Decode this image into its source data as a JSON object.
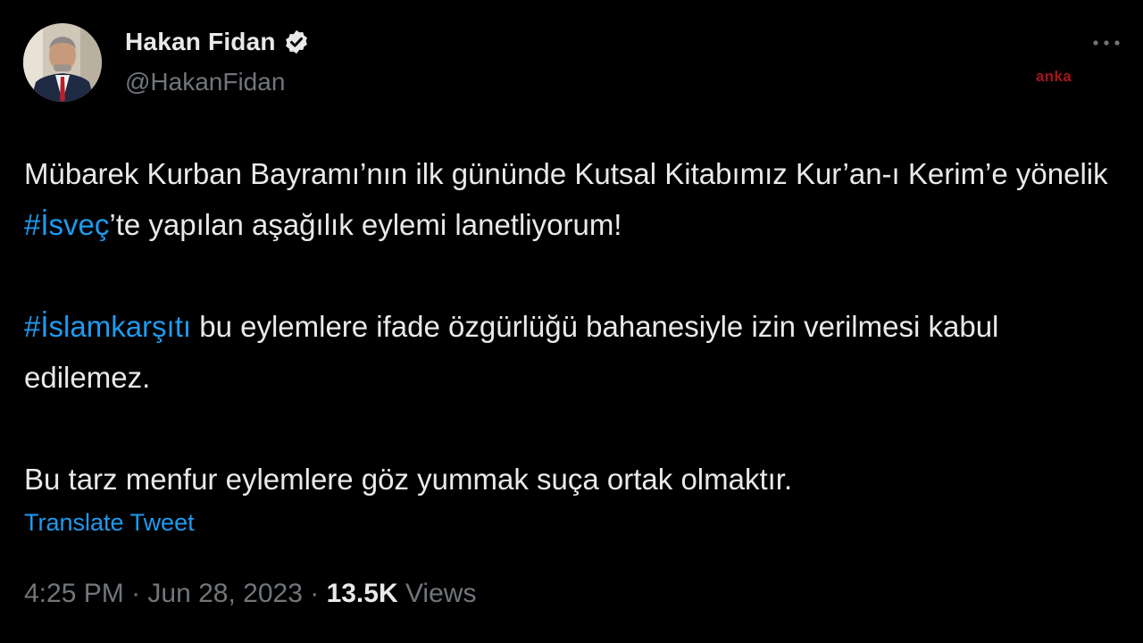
{
  "author": {
    "display_name": "Hakan Fidan",
    "handle": "@HakanFidan",
    "verified": true
  },
  "watermark": "anka",
  "tweet": {
    "para1_before": "Mübarek Kurban Bayramı’nın ilk gününde Kutsal Kitabımız Kur’an-ı Kerim’e yönelik ",
    "para1_hashtag": "#İsveç",
    "para1_after": "’te yapılan aşağılık eylemi lanetliyorum!",
    "para2_hashtag": "#İslamkarşıtı",
    "para2_after": " bu eylemlere ifade özgürlüğü bahanesiyle izin verilmesi kabul edilemez.",
    "para3": "Bu tarz menfur eylemlere göz yummak suça ortak olmaktır."
  },
  "translate_label": "Translate Tweet",
  "meta": {
    "time": "4:25 PM",
    "separator": " · ",
    "date": "Jun 28, 2023",
    "views_count": "13.5K",
    "views_label": " Views"
  },
  "icons": {
    "verified": "verified-badge-icon",
    "more": "more-options-icon"
  },
  "colors": {
    "background": "#000000",
    "text": "#e7e9ea",
    "secondary": "#71767b",
    "link": "#1d9bf0",
    "watermark": "#a4151b"
  }
}
